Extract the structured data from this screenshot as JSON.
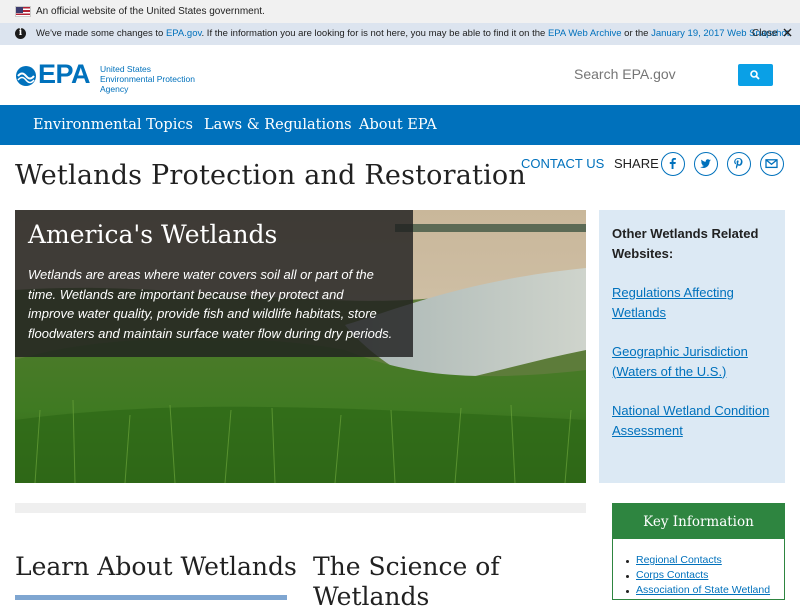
{
  "gov_banner": {
    "text": "An official website of the United States government."
  },
  "notice": {
    "text_1": "We've made some changes to ",
    "link_1": "EPA.gov",
    "text_2": ". If the information you are looking for is not here, you may be able to find it on the ",
    "link_2": "EPA Web Archive",
    "text_3": " or the ",
    "link_3": "January 19, 2017 Web Snapshot",
    "text_4": ".",
    "close": "Close"
  },
  "header": {
    "logo": "EPA",
    "agency_line1": "United States",
    "agency_line2": "Environmental Protection",
    "agency_line3": "Agency",
    "search_placeholder": "Search EPA.gov"
  },
  "nav": {
    "items": [
      "Environmental Topics",
      "Laws & Regulations",
      "About EPA"
    ]
  },
  "page": {
    "title": "Wetlands Protection and Restoration",
    "contact": "CONTACT US",
    "share": "SHARE"
  },
  "share_icons": [
    "facebook-icon",
    "twitter-icon",
    "pinterest-icon",
    "email-icon"
  ],
  "hero": {
    "title": "America's Wetlands",
    "text": "Wetlands are areas where water covers soil all or part of the time. Wetlands are important because they protect and improve water quality, provide fish and wildlife habitats, store floodwaters and maintain surface water flow during dry periods."
  },
  "sidebar": {
    "title": "Other Wetlands Related Websites:",
    "links": [
      "Regulations Affecting Wetlands",
      "Geographic Jurisdiction (Waters of the U.S.)",
      "National Wetland Condition Assessment"
    ]
  },
  "sections": {
    "learn": "Learn About Wetlands",
    "science": "The Science of Wetlands"
  },
  "key_info": {
    "title": "Key Information",
    "links": [
      "Regional Contacts",
      "Corps Contacts",
      "Association of State Wetland"
    ]
  },
  "colors": {
    "epa_blue": "#0071bc",
    "nav_blue": "#0071bc",
    "key_green": "#2e8540",
    "sidebar_bg": "#dce9f4"
  }
}
